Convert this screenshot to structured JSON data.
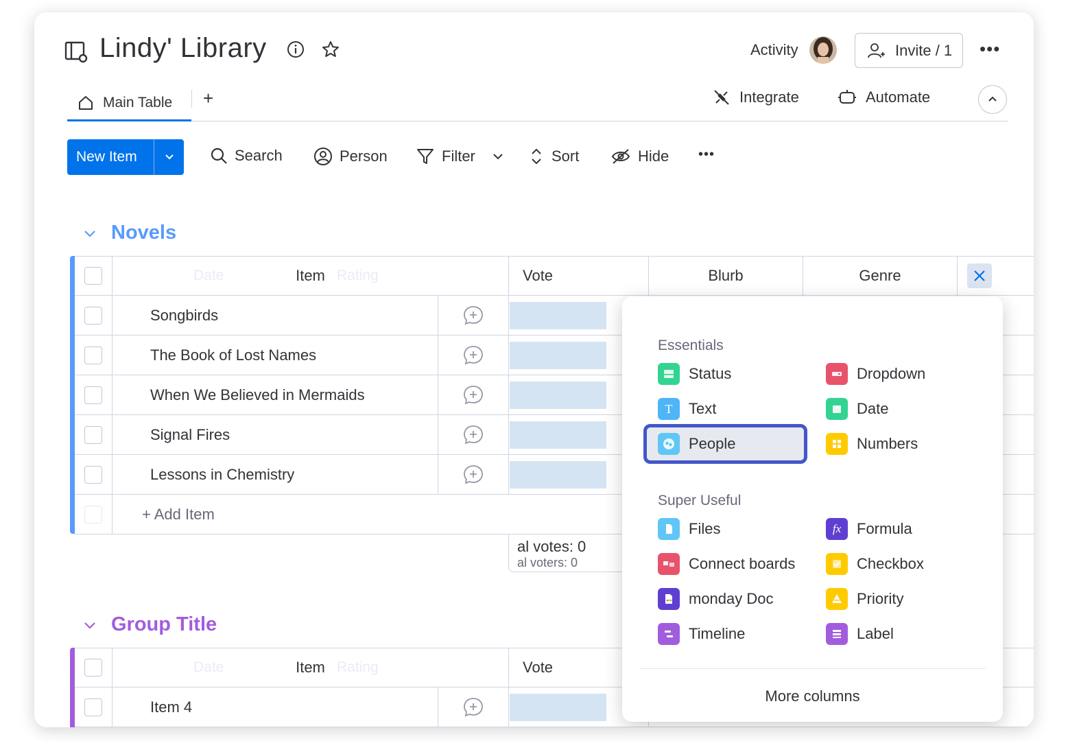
{
  "header": {
    "title": "Lindy' Library",
    "activity_label": "Activity",
    "invite_label": "Invite / 1"
  },
  "tabs": {
    "main_table": "Main Table",
    "add": "+",
    "integrate": "Integrate",
    "automate": "Automate"
  },
  "toolbar": {
    "new_item": "New Item",
    "search": "Search",
    "person": "Person",
    "filter": "Filter",
    "sort": "Sort",
    "hide": "Hide"
  },
  "groups": [
    {
      "title": "Novels",
      "color": "#579bfc",
      "columns": {
        "ghost_date": "Date",
        "item": "Item",
        "ghost_rating": "Rating",
        "vote": "Vote",
        "blurb": "Blurb",
        "genre": "Genre"
      },
      "rows": [
        "Songbirds",
        "The Book of Lost Names",
        "When We Believed in Mermaids",
        "Signal Fires",
        "Lessons in Chemistry"
      ],
      "add_item": "+ Add Item",
      "summary": {
        "total_votes": "al votes: 0",
        "total_voters": "al voters: 0"
      }
    },
    {
      "title": "Group Title",
      "color": "#a25ddc",
      "columns": {
        "ghost_date": "Date",
        "item": "Item",
        "ghost_rating": "Rating",
        "vote": "Vote"
      },
      "rows": [
        "Item 4"
      ]
    }
  ],
  "column_picker": {
    "essentials_label": "Essentials",
    "super_useful_label": "Super Useful",
    "essentials": [
      {
        "label": "Status",
        "icon": "status-icon",
        "color": "#33d391"
      },
      {
        "label": "Dropdown",
        "icon": "dropdown-icon",
        "color": "#e8536c"
      },
      {
        "label": "Text",
        "icon": "text-icon",
        "color": "#4eb5f7"
      },
      {
        "label": "Date",
        "icon": "date-icon",
        "color": "#33d391"
      },
      {
        "label": "People",
        "icon": "people-icon",
        "color": "#5fc6f5"
      },
      {
        "label": "Numbers",
        "icon": "numbers-icon",
        "color": "#ffcb00"
      }
    ],
    "super_useful": [
      {
        "label": "Files",
        "icon": "files-icon",
        "color": "#5fc6f5"
      },
      {
        "label": "Formula",
        "icon": "formula-icon",
        "color": "#5f3fd1"
      },
      {
        "label": "Connect boards",
        "icon": "connect-boards-icon",
        "color": "#e8536c"
      },
      {
        "label": "Checkbox",
        "icon": "checkbox-icon",
        "color": "#ffcb00"
      },
      {
        "label": "monday Doc",
        "icon": "monday-doc-icon",
        "color": "#5f3fd1"
      },
      {
        "label": "Priority",
        "icon": "priority-icon",
        "color": "#ffcb00"
      },
      {
        "label": "Timeline",
        "icon": "timeline-icon",
        "color": "#a25ddc"
      },
      {
        "label": "Label",
        "icon": "label-icon",
        "color": "#a25ddc"
      }
    ],
    "more_columns": "More columns"
  }
}
